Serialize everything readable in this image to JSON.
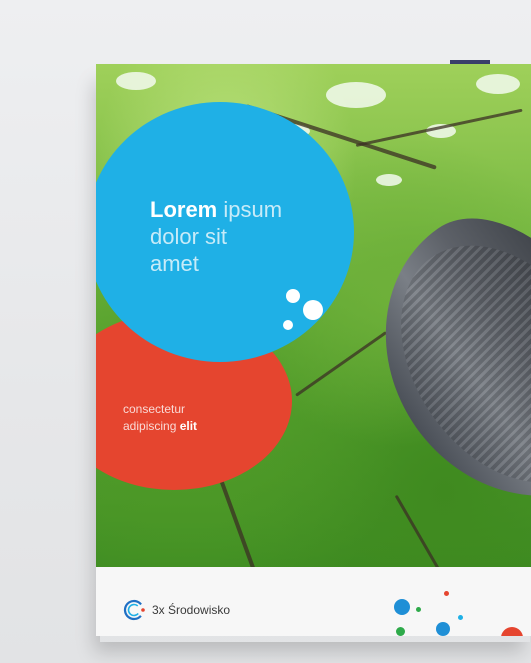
{
  "poster": {
    "heading": {
      "bold": "Lorem",
      "rest_line1": " ipsum",
      "line2": "dolor sit",
      "line3": "amet"
    },
    "subheading": {
      "line1": "consectetur",
      "line2_light": "adipiscing ",
      "line2_bold": "elit"
    },
    "footer": {
      "logo_text": "3x Środowisko"
    }
  },
  "colors": {
    "blue": "#1fb0e6",
    "red": "#e5452f",
    "green": "#2eaa4a",
    "footer_blue": "#1f6fc4"
  },
  "icons": [
    "logo-c-icon"
  ]
}
